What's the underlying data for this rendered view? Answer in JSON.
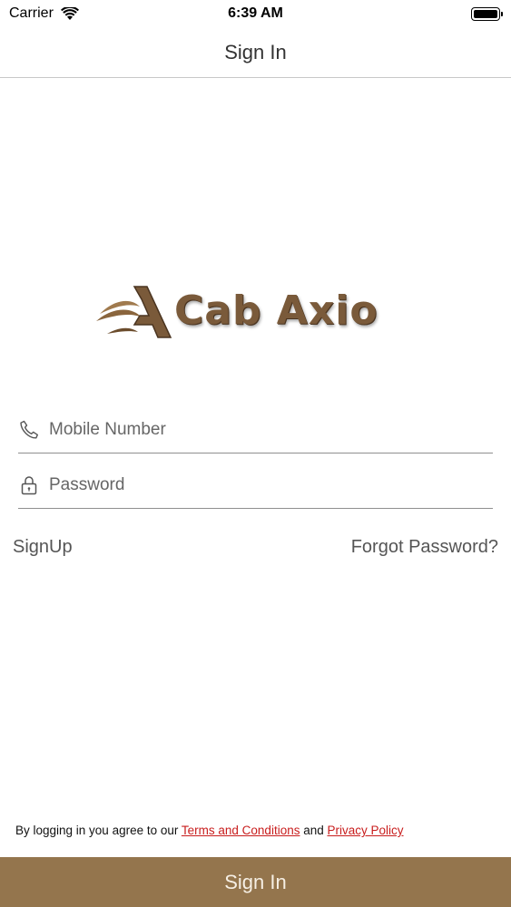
{
  "status_bar": {
    "carrier": "Carrier",
    "time": "6:39 AM"
  },
  "nav": {
    "title": "Sign In"
  },
  "logo": {
    "text": "Cab Axio",
    "mark_letter": "A"
  },
  "form": {
    "mobile": {
      "placeholder": "Mobile Number",
      "value": "",
      "icon": "phone-icon"
    },
    "password": {
      "placeholder": "Password",
      "value": "",
      "icon": "lock-icon"
    }
  },
  "links": {
    "signup": "SignUp",
    "forgot": "Forgot Password?"
  },
  "terms": {
    "prefix": "By logging in you agree to our ",
    "terms_link": "Terms and Conditions",
    "middle": " and ",
    "privacy_link": "Privacy Policy"
  },
  "primary_button": {
    "label": "Sign In"
  },
  "colors": {
    "brand": "#94754d",
    "link_red": "#c81d1d",
    "logo_brown": "#7a5a3a"
  }
}
